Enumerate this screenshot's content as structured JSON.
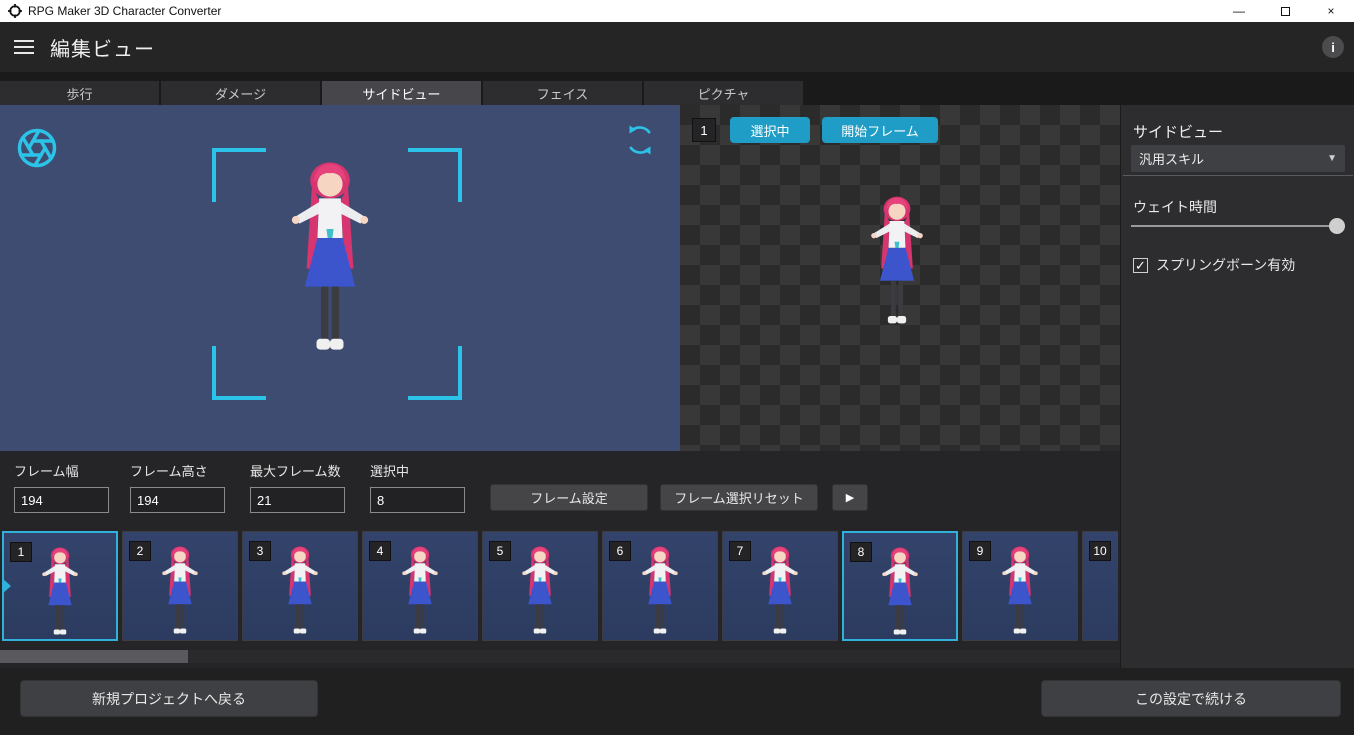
{
  "titlebar": {
    "app_title": "RPG Maker 3D Character Converter"
  },
  "header": {
    "title": "編集ビュー"
  },
  "tabs": [
    {
      "label": "歩行"
    },
    {
      "label": "ダメージ"
    },
    {
      "label": "サイドビュー"
    },
    {
      "label": "フェイス"
    },
    {
      "label": "ピクチャ"
    }
  ],
  "active_tab_index": 2,
  "preview": {
    "frame_badge": "1",
    "selected_button": "選択中",
    "start_frame_button": "開始フレーム"
  },
  "side_panel": {
    "title": "サイドビュー",
    "dropdown_value": "汎用スキル",
    "wait_time_label": "ウェイト時間",
    "slider_percent": 100,
    "spring_bone_label": "スプリングボーン有効",
    "spring_bone_checked": true
  },
  "frame_settings": {
    "fields": [
      {
        "label": "フレーム幅",
        "value": "194"
      },
      {
        "label": "フレーム高さ",
        "value": "194"
      },
      {
        "label": "最大フレーム数",
        "value": "21"
      },
      {
        "label": "選択中",
        "value": "8"
      }
    ],
    "set_button": "フレーム設定",
    "reset_button": "フレーム選択リセット"
  },
  "frames": [
    {
      "number": "1",
      "selected": true,
      "marker": true
    },
    {
      "number": "2",
      "selected": false
    },
    {
      "number": "3",
      "selected": false
    },
    {
      "number": "4",
      "selected": false
    },
    {
      "number": "5",
      "selected": false
    },
    {
      "number": "6",
      "selected": false
    },
    {
      "number": "7",
      "selected": false
    },
    {
      "number": "8",
      "selected": true
    },
    {
      "number": "9",
      "selected": false
    },
    {
      "number": "10",
      "selected": false
    }
  ],
  "footer": {
    "back_button": "新規プロジェクトへ戻る",
    "continue_button": "この設定で続ける"
  },
  "icons": {
    "play": "▶",
    "caret": "▼",
    "check": "✓",
    "close": "×",
    "minimize": "—",
    "info": "i"
  },
  "colors": {
    "accent": "#1f9dc6",
    "accent_bright": "#2cc3e8",
    "preview_bg": "#3e4c71",
    "thumbnail_bg": "#2c3b5f",
    "selected_border": "#2fb1dc"
  }
}
